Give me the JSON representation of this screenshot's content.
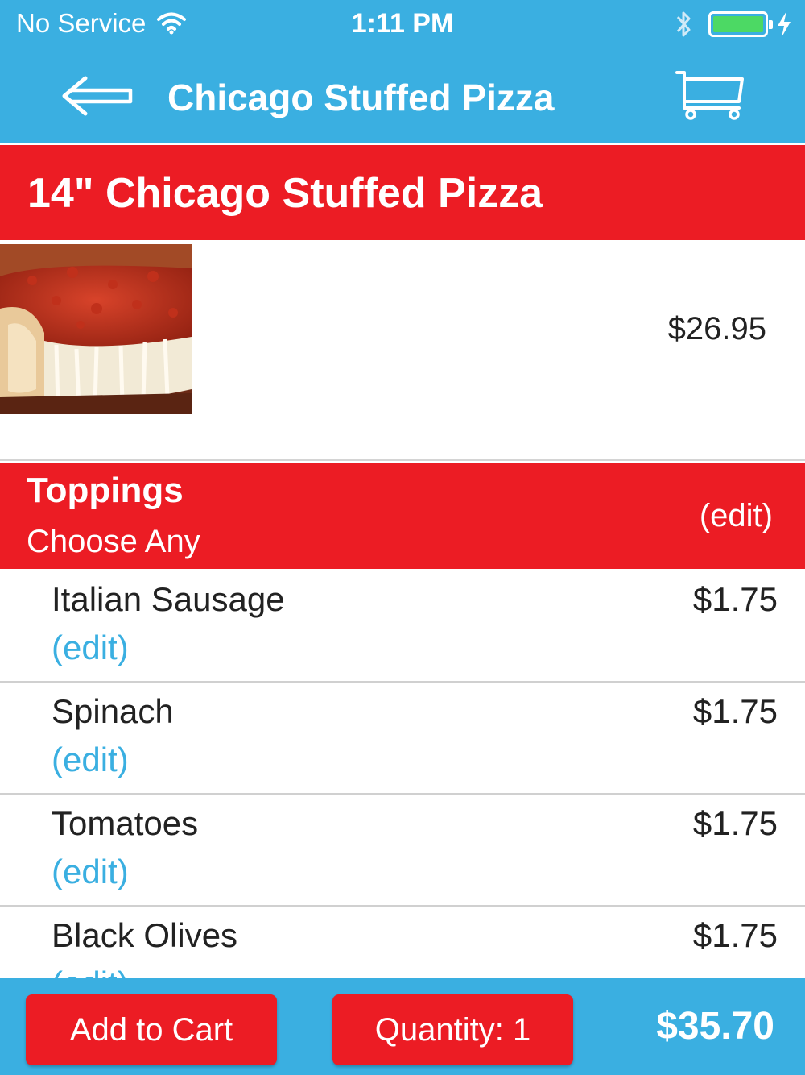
{
  "status_bar": {
    "carrier": "No Service",
    "time": "1:11 PM",
    "battery_color": "#4cd964"
  },
  "nav": {
    "title": "Chicago Stuffed Pizza",
    "back_icon": "arrow-left-icon",
    "cart_icon": "cart-icon"
  },
  "item": {
    "name": "14\" Chicago Stuffed Pizza",
    "price": "$26.95",
    "image": "chicago-stuffed-pizza-photo"
  },
  "toppings_section": {
    "title": "Toppings",
    "subtitle": "Choose Any",
    "edit_label": "(edit)"
  },
  "toppings": [
    {
      "name": "Italian Sausage",
      "price": "$1.75",
      "edit": "(edit)"
    },
    {
      "name": "Spinach",
      "price": "$1.75",
      "edit": "(edit)"
    },
    {
      "name": "Tomatoes",
      "price": "$1.75",
      "edit": "(edit)"
    },
    {
      "name": "Black Olives",
      "price": "$1.75",
      "edit": "(edit)"
    }
  ],
  "footer": {
    "add_to_cart": "Add to Cart",
    "quantity": "Quantity: 1",
    "total": "$35.70"
  },
  "colors": {
    "primary_blue": "#3aafe1",
    "accent_red": "#ec1c24",
    "link_blue": "#3aafe1"
  }
}
